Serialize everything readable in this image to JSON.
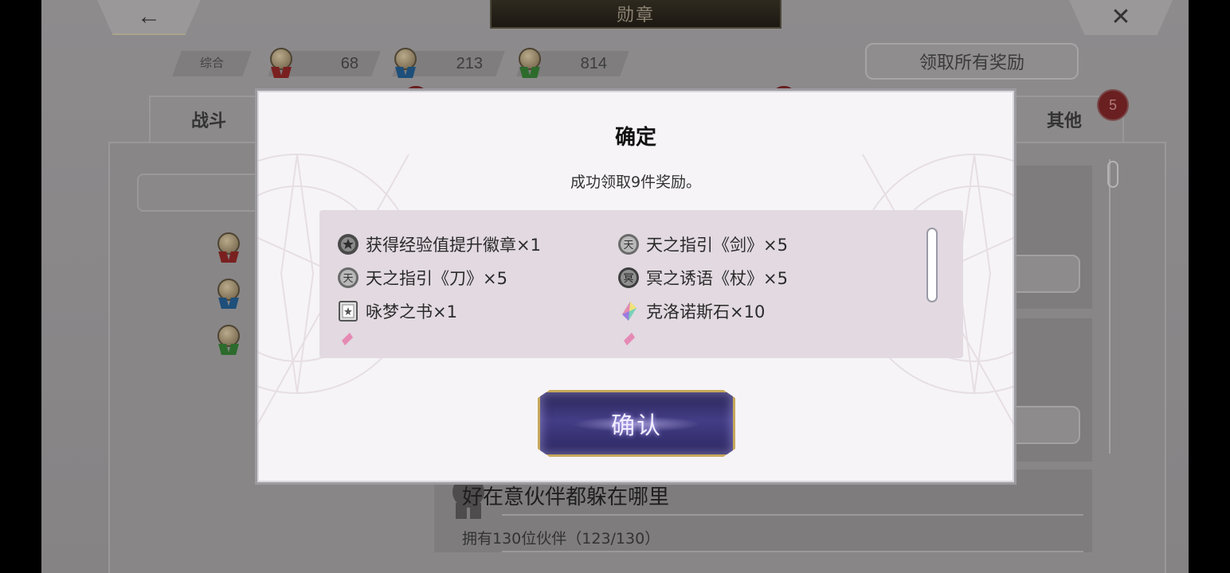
{
  "header": {
    "title": "勋章",
    "back_icon": "←",
    "close_icon": "✕"
  },
  "summary": {
    "label": "综合",
    "counts": [
      {
        "value": "68",
        "ribbon_color": "#7a2020"
      },
      {
        "value": "213",
        "ribbon_color": "#1d4f7a"
      },
      {
        "value": "814",
        "ribbon_color": "#2d6b2d"
      }
    ]
  },
  "claim_all_label": "领取所有奖励",
  "tabs": {
    "battle": "战斗",
    "other": "其他",
    "other_badge": "5"
  },
  "background_card": {
    "title": "好在意伙伴都躲在哪里",
    "subtitle": "拥有130位伙伴（123/130）"
  },
  "modal": {
    "title": "确定",
    "message": "成功领取9件奖励。",
    "rewards": [
      {
        "text": "获得经验值提升徽章×1",
        "icon": "badge-star-icon"
      },
      {
        "text": "天之指引《剑》×5",
        "icon": "heaven-guide-icon"
      },
      {
        "text": "天之指引《刀》×5",
        "icon": "heaven-guide-icon"
      },
      {
        "text": "冥之诱语《杖》×5",
        "icon": "underworld-whisper-icon"
      },
      {
        "text": "咏梦之书×1",
        "icon": "dream-book-icon"
      },
      {
        "text": "克洛诺斯石×10",
        "icon": "chronos-stone-icon"
      }
    ],
    "confirm_label": "确认"
  },
  "colors": {
    "accent_gold": "#c7a85b",
    "button_purple": "#433d86",
    "panel_bg": "#f6f4f7",
    "list_bg": "#e2d9e1"
  }
}
